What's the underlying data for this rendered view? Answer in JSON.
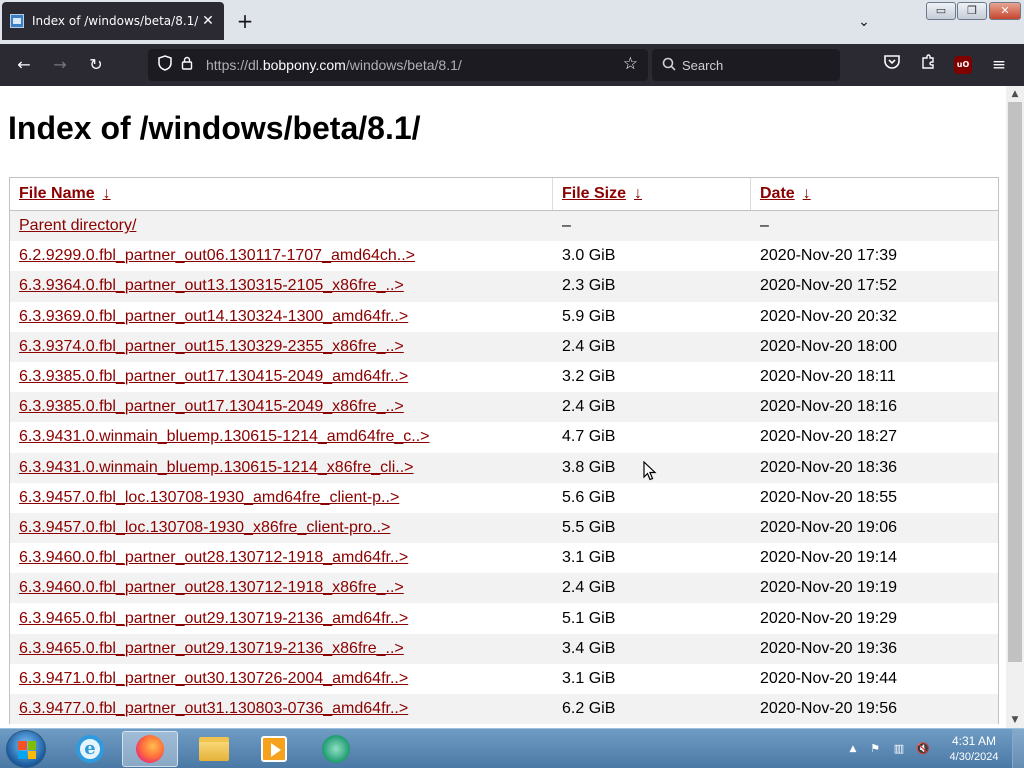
{
  "browser": {
    "tab": {
      "title": "Index of /windows/beta/8.1/",
      "close_glyph": "✕",
      "favicon": "ie-page-icon"
    },
    "new_tab_glyph": "+",
    "tab_list_glyph": "⌄",
    "window_controls": {
      "minimize": "▭",
      "maximize": "❐",
      "close": "✕"
    },
    "url": {
      "prefix": "https://dl.",
      "host": "bobpony.com",
      "path": "/windows/beta/8.1/"
    },
    "search_placeholder": "Search",
    "icons": {
      "back": "←",
      "forward": "→",
      "reload": "↻",
      "shield": "⛉",
      "lock": "🔒",
      "star": "☆",
      "search": "⌕",
      "pocket": "♡",
      "extensions": "⚙",
      "ublock_text": "uO",
      "menu": "≡"
    }
  },
  "page": {
    "title": "Index of /windows/beta/8.1/",
    "columns": [
      {
        "label": "File Name",
        "arrow": "↓"
      },
      {
        "label": "File Size",
        "arrow": "↓"
      },
      {
        "label": "Date",
        "arrow": "↓"
      }
    ],
    "rows": [
      {
        "name": "Parent directory/",
        "size": "–",
        "date": "–"
      },
      {
        "name": "6.2.9299.0.fbl_partner_out06.130117-1707_amd64ch..>",
        "size": "3.0 GiB",
        "date": "2020-Nov-20 17:39"
      },
      {
        "name": "6.3.9364.0.fbl_partner_out13.130315-2105_x86fre_..>",
        "size": "2.3 GiB",
        "date": "2020-Nov-20 17:52"
      },
      {
        "name": "6.3.9369.0.fbl_partner_out14.130324-1300_amd64fr..>",
        "size": "5.9 GiB",
        "date": "2020-Nov-20 20:32"
      },
      {
        "name": "6.3.9374.0.fbl_partner_out15.130329-2355_x86fre_..>",
        "size": "2.4 GiB",
        "date": "2020-Nov-20 18:00"
      },
      {
        "name": "6.3.9385.0.fbl_partner_out17.130415-2049_amd64fr..>",
        "size": "3.2 GiB",
        "date": "2020-Nov-20 18:11"
      },
      {
        "name": "6.3.9385.0.fbl_partner_out17.130415-2049_x86fre_..>",
        "size": "2.4 GiB",
        "date": "2020-Nov-20 18:16"
      },
      {
        "name": "6.3.9431.0.winmain_bluemp.130615-1214_amd64fre_c..>",
        "size": "4.7 GiB",
        "date": "2020-Nov-20 18:27"
      },
      {
        "name": "6.3.9431.0.winmain_bluemp.130615-1214_x86fre_cli..>",
        "size": "3.8 GiB",
        "date": "2020-Nov-20 18:36"
      },
      {
        "name": "6.3.9457.0.fbl_loc.130708-1930_amd64fre_client-p..>",
        "size": "5.6 GiB",
        "date": "2020-Nov-20 18:55"
      },
      {
        "name": "6.3.9457.0.fbl_loc.130708-1930_x86fre_client-pro..>",
        "size": "5.5 GiB",
        "date": "2020-Nov-20 19:06"
      },
      {
        "name": "6.3.9460.0.fbl_partner_out28.130712-1918_amd64fr..>",
        "size": "3.1 GiB",
        "date": "2020-Nov-20 19:14"
      },
      {
        "name": "6.3.9460.0.fbl_partner_out28.130712-1918_x86fre_..>",
        "size": "2.4 GiB",
        "date": "2020-Nov-20 19:19"
      },
      {
        "name": "6.3.9465.0.fbl_partner_out29.130719-2136_amd64fr..>",
        "size": "5.1 GiB",
        "date": "2020-Nov-20 19:29"
      },
      {
        "name": "6.3.9465.0.fbl_partner_out29.130719-2136_x86fre_..>",
        "size": "3.4 GiB",
        "date": "2020-Nov-20 19:36"
      },
      {
        "name": "6.3.9471.0.fbl_partner_out30.130726-2004_amd64fr..>",
        "size": "3.1 GiB",
        "date": "2020-Nov-20 19:44"
      },
      {
        "name": "6.3.9477.0.fbl_partner_out31.130803-0736_amd64fr..>",
        "size": "6.2 GiB",
        "date": "2020-Nov-20 19:56"
      }
    ]
  },
  "taskbar": {
    "apps": [
      "internet-explorer",
      "firefox",
      "file-explorer",
      "media-player",
      "app"
    ],
    "tray_icons": {
      "up": "▲",
      "flag": "⚑",
      "network": "▥",
      "volume": "🔇"
    },
    "time": "4:31 AM",
    "date": "4/30/2024"
  },
  "scrollbar_glyphs": {
    "up": "▲",
    "down": "▼"
  }
}
